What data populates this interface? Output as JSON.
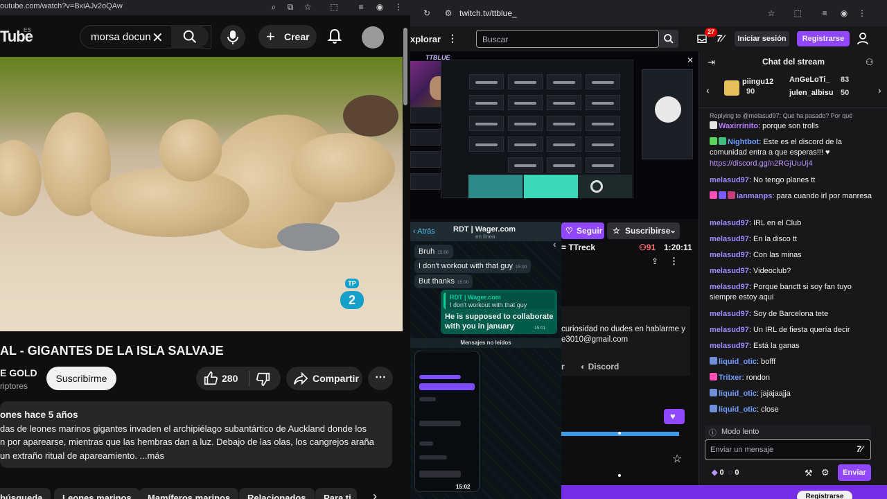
{
  "youtube": {
    "url": "outube.com/watch?v=BxiAJv2oQAw",
    "logo": "Tube",
    "logo_region": "ES",
    "search_value": "morsa docun",
    "create_label": "Crear",
    "title": "AL - GIGANTES DE LA ISLA SALVAJE",
    "channel": "E GOLD",
    "subscribers": "riptores",
    "subscribe_label": "Suscribirme",
    "likes": "280",
    "share_label": "Compartir",
    "desc_meta": "ones  hace 5 años",
    "desc_lines": [
      "das de leones marinos gigantes invaden el archipiélago subantártico de Auckland donde los",
      "n por aparearse, mientras que las hembras dan a luz. Debajo de las olas, los cangrejos araña",
      "un extraño ritual de apareamiento. ...más"
    ],
    "chips": [
      "búsqueda",
      "Leones marinos",
      "Mamíferos marinos",
      "Relacionados",
      "Para ti"
    ],
    "badge_top": "TP",
    "badge_num": "2"
  },
  "twitch": {
    "url": "twitch.tv/ttblue_",
    "explore_label": "xplorar",
    "search_placeholder": "Buscar",
    "notif_count": "27",
    "login_label": "Iniciar sesión",
    "register_label": "Registrarse",
    "stream_logo": "TTBLUE",
    "follow_label": "Seguir",
    "subscribe_label": "Suscribirse",
    "game": "= TTreck",
    "viewers": "91",
    "uptime": "1:20:11",
    "about_lines": [
      "curiosidad no dudes en hablarme y",
      "e3010@gmail.com"
    ],
    "discord_label": "Discord",
    "follow_short": "r",
    "bottom_btn": "Registrarse"
  },
  "whatsapp": {
    "back_label": "Atrás",
    "contact": "RDT | Wager.com",
    "status": "en línea",
    "incoming": [
      {
        "text": "Bruh",
        "time": "15:00"
      },
      {
        "text": "I don't workout with that guy",
        "time": "15:00"
      },
      {
        "text": "But thanks",
        "time": "15:00"
      }
    ],
    "quote_name": "RDT | Wager.com",
    "quote_text": "I don't workout with that guy",
    "outgoing_text": "He is supposed to collaborate with you in january",
    "outgoing_time": "15:01",
    "unread_label": "Mensajes no leídos",
    "phone_time": "15:02"
  },
  "chat": {
    "title": "Chat del stream",
    "gifts": [
      {
        "user": "piingu12",
        "count": "90"
      },
      {
        "user": "AnGeLoTi_",
        "count": "83"
      },
      {
        "user": "julen_albisu",
        "count": "50"
      }
    ],
    "replying": "Replying to @melasud97: Que ha pasado? Por qué",
    "messages": [
      {
        "user": "Waxirrinito",
        "text": ": porque son trolls",
        "color": "#b57cff"
      },
      {
        "user": "Nightbot",
        "text": ": Este es el discord de la comunidad entra a que esperas!!! ♥",
        "color": "#6e9cff"
      },
      {
        "user": "",
        "text": "https://discord.gg/n2RGjUuUj4",
        "color": "#bf94ff"
      },
      {
        "user": "melasud97",
        "text": ": No tengo planes tt",
        "color": "#9e8cff"
      },
      {
        "user": "ianmanps",
        "text": ": para cuando irl por manresa",
        "color": "#9e8cff"
      },
      {
        "user": "melasud97",
        "text": ": IRL en el Club",
        "color": "#9e8cff"
      },
      {
        "user": "melasud97",
        "text": ": En la disco tt",
        "color": "#9e8cff"
      },
      {
        "user": "melasud97",
        "text": ": Con las minas",
        "color": "#9e8cff"
      },
      {
        "user": "melasud97",
        "text": ": Videoclub?",
        "color": "#9e8cff"
      },
      {
        "user": "melasud97",
        "text": ": Porque banctt si soy fan tuyo siempre estoy aqui",
        "color": "#9e8cff"
      },
      {
        "user": "melasud97",
        "text": ": Soy de Barcelona tete",
        "color": "#9e8cff"
      },
      {
        "user": "melasud97",
        "text": ": Un IRL de fiesta quería decir",
        "color": "#9e8cff"
      },
      {
        "user": "melasud97",
        "text": ": Está la ganas",
        "color": "#9e8cff"
      },
      {
        "user": "liquid_otic",
        "text": ": bofff",
        "color": "#6e9cff"
      },
      {
        "user": "Tritxer",
        "text": ": rondon",
        "color": "#6e9cff"
      },
      {
        "user": "liquid_otic",
        "text": ": jajajaajja",
        "color": "#6e9cff"
      },
      {
        "user": "liquid_otic",
        "text": ": close",
        "color": "#6e9cff"
      }
    ],
    "slow_mode": "Modo lento",
    "input_placeholder": "Enviar un mensaje",
    "points_a": "0",
    "points_b": "0",
    "send_label": "Enviar"
  }
}
